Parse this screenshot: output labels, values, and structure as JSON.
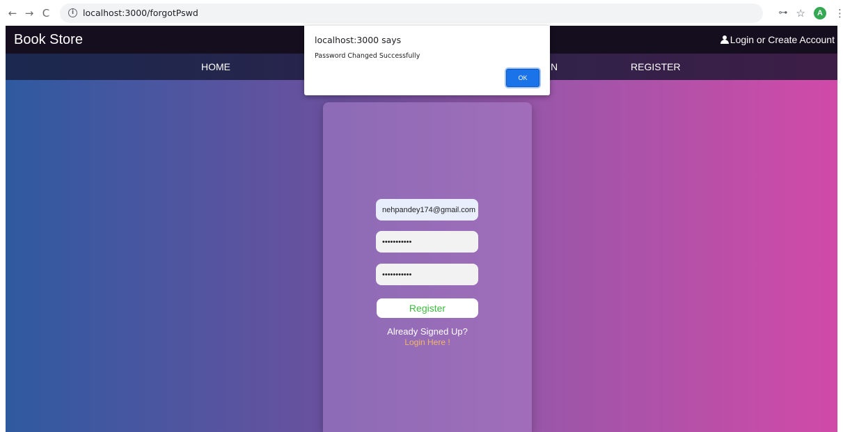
{
  "browser": {
    "back": "←",
    "forward": "→",
    "reload": "C",
    "info": "i",
    "url": "localhost:3000/forgotPswd",
    "key": "⊶",
    "star": "☆",
    "profile_initial": "A",
    "menu": "⋮"
  },
  "header": {
    "brand": "Book Store",
    "account_link": "Login or Create Account"
  },
  "nav": {
    "items": [
      "HOME",
      "",
      "N",
      "REGISTER"
    ]
  },
  "form": {
    "email_value": "nehpandey174@gmail.com",
    "password_value": "•••••••••••",
    "confirm_value": "•••••••••••",
    "submit_label": "Register",
    "already_text": "Already Signed Up?",
    "login_link": "Login Here !"
  },
  "dialog": {
    "title": "localhost:3000 says",
    "message": "Password Changed Successfully",
    "ok_label": "OK"
  },
  "colors": {
    "ok_button": "#1a73e8",
    "register_text": "#3dbb3d",
    "login_link": "#f0b76a"
  }
}
